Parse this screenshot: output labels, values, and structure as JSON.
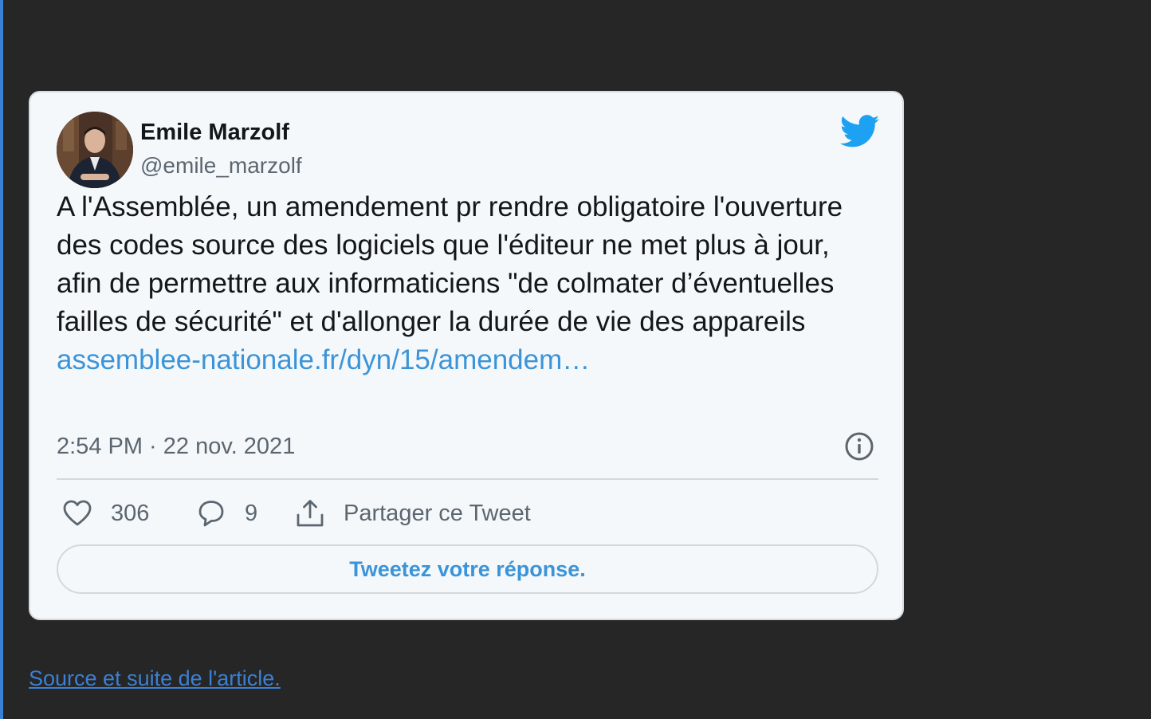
{
  "tweet": {
    "author_name": "Emile Marzolf",
    "author_handle": "@emile_marzolf",
    "text": "A l'Assemblée, un amendement pr rendre obligatoire l'ouverture des codes source des logiciels que l'éditeur ne met plus à jour, afin de permettre aux informaticiens \"de colmater d’éventuelles failles de sécurité\" et d'allonger la durée de vie des appareils ",
    "link_text": "assemblee-nationale.fr/dyn/15/amendem…",
    "timestamp": "2:54 PM · 22 nov. 2021",
    "likes": "306",
    "replies": "9",
    "share_label": "Partager ce Tweet",
    "reply_prompt": "Tweetez votre réponse."
  },
  "footer": {
    "source_link": "Source et suite de l'article."
  },
  "colors": {
    "page_background": "#262626",
    "card_background": "#f5f8fa",
    "link_blue": "#3b94d9",
    "twitter_blue": "#1da1f2",
    "accent_rule": "#3a80d4"
  },
  "icons": {
    "brand": "twitter-bird-icon",
    "info": "info-icon",
    "like": "heart-icon",
    "reply": "speech-bubble-icon",
    "share": "share-upload-icon"
  }
}
